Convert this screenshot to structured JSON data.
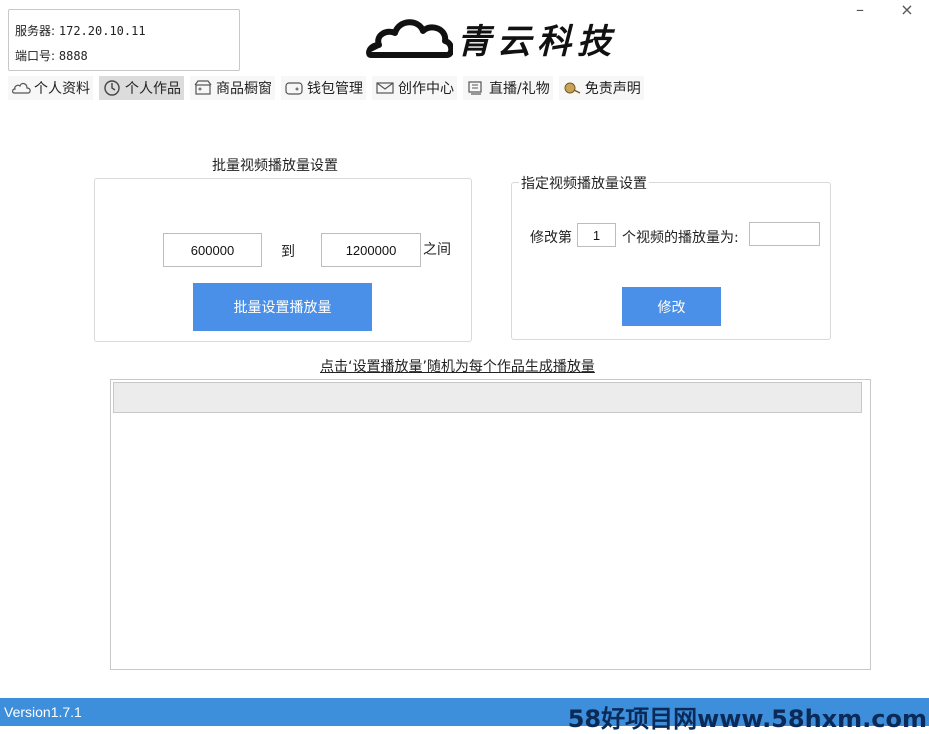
{
  "server": {
    "server_label": "服务器:",
    "server_value": "172.20.10.11",
    "port_label": "端口号:",
    "port_value": "8888"
  },
  "logo": {
    "text": "青云科技"
  },
  "window": {
    "minimize": "–",
    "close": "×"
  },
  "tabs": [
    {
      "label": "个人资料",
      "icon": "cloud-icon"
    },
    {
      "label": "个人作品",
      "icon": "clock-icon",
      "active": true
    },
    {
      "label": "商品橱窗",
      "icon": "shop-icon"
    },
    {
      "label": "钱包管理",
      "icon": "wallet-icon"
    },
    {
      "label": "创作中心",
      "icon": "mail-icon"
    },
    {
      "label": "直播/礼物",
      "icon": "monitor-icon"
    },
    {
      "label": "免责声明",
      "icon": "lion-icon"
    }
  ],
  "batch": {
    "title": "批量视频播放量设置",
    "min_value": "600000",
    "to_label": "到",
    "max_value": "1200000",
    "between_label": "之间",
    "button": "批量设置播放量"
  },
  "single": {
    "title": "指定视频播放量设置",
    "prefix": "修改第",
    "index_value": "1",
    "middle": "个视频的播放量为:",
    "count_value": "",
    "button": "修改"
  },
  "hint": "点击‘设置播放量’随机为每个作品生成播放量",
  "footer": {
    "version": "Version1.7.1",
    "watermark": "58好项目网www.58hxm.com"
  },
  "colors": {
    "accent": "#4a90e8",
    "statusbar": "#3d8edb"
  }
}
